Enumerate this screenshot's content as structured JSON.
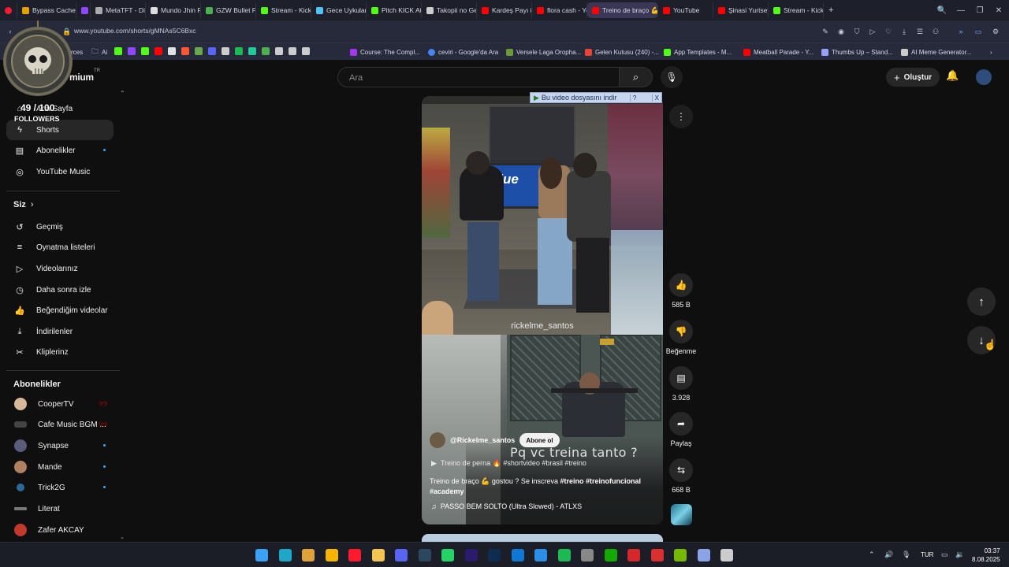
{
  "browser": {
    "tabs": [
      {
        "label": "Bypass Cache",
        "color": "#e5a000"
      },
      {
        "label": "",
        "color": "#9146ff"
      },
      {
        "label": "MetaTFT - Dis",
        "color": "#aaaaaa"
      },
      {
        "label": "Mundo Jhin Re",
        "color": "#dddddd"
      },
      {
        "label": "GZW Bullet Pe",
        "color": "#4caf50"
      },
      {
        "label": "Stream - Kick C",
        "color": "#53fc18"
      },
      {
        "label": "Gece Uykuları",
        "color": "#4fc3f7"
      },
      {
        "label": "Pitch KICK Ath",
        "color": "#53fc18"
      },
      {
        "label": "Takopii no Gen",
        "color": "#cccccc"
      },
      {
        "label": "Kardeş Payı 8.B",
        "color": "#ff0000"
      },
      {
        "label": "flora cash - Yo",
        "color": "#ff0000"
      },
      {
        "label": "Treino de braço 💪 g",
        "color": "#ff0000"
      },
      {
        "label": "YouTube",
        "color": "#ff0000"
      },
      {
        "label": "Şinasi Yurtsev",
        "color": "#ff0000"
      },
      {
        "label": "Stream - Kick C",
        "color": "#53fc18"
      }
    ],
    "active_tab_index": 11,
    "new_tab": "+",
    "url": "www.youtube.com/shorts/gMNAs5C6Bxc",
    "bookmarks": [
      {
        "label": "rces",
        "color": "#888888"
      },
      {
        "label": "Ai",
        "color": "#cccccc"
      },
      {
        "label": "Course: The Compl...",
        "color": "#a435f0"
      },
      {
        "label": "ceviri - Google'da Ara",
        "color": "#4285f4"
      },
      {
        "label": "Versele Laga Oropha...",
        "color": "#6a9a3a"
      },
      {
        "label": "Gelen Kutusu (240) -...",
        "color": "#ea4335"
      },
      {
        "label": "App Templates - M...",
        "color": "#53fc18"
      },
      {
        "label": "Meatball Parade - Y...",
        "color": "#ff0000"
      },
      {
        "label": "Thumbs Up – Stand...",
        "color": "#9aa0ff"
      },
      {
        "label": "AI Meme Generator...",
        "color": "#cccccc"
      }
    ]
  },
  "youtube": {
    "logo_text": "mium",
    "logo_tr": "TR",
    "search_placeholder": "Ara",
    "create_label": "Oluştur",
    "sidebar": {
      "main": [
        {
          "label": "Ana Sayfa",
          "icon": "home-icon"
        },
        {
          "label": "Shorts",
          "icon": "shorts-icon",
          "active": true
        },
        {
          "label": "Abonelikler",
          "icon": "subscriptions-icon"
        },
        {
          "label": "YouTube Music",
          "icon": "music-icon"
        }
      ],
      "you_header": "Siz",
      "you_items": [
        {
          "label": "Geçmiş",
          "icon": "history-icon"
        },
        {
          "label": "Oynatma listeleri",
          "icon": "playlist-icon"
        },
        {
          "label": "Videolarınız",
          "icon": "video-icon"
        },
        {
          "label": "Daha sonra izle",
          "icon": "clock-icon"
        },
        {
          "label": "Beğendiğim videolar",
          "icon": "like-icon"
        },
        {
          "label": "İndirilenler",
          "icon": "download-icon"
        },
        {
          "label": "Kliplerinz",
          "icon": "scissors-icon"
        }
      ],
      "subs_header": "Abonelikler",
      "subs": [
        {
          "label": "CooperTV",
          "color": "#d9b89a",
          "live": true
        },
        {
          "label": "Cafe Music BGM ...",
          "color": "#444444",
          "live": true
        },
        {
          "label": "Synapse",
          "color": "#5a5a7a",
          "live": false,
          "dot": true
        },
        {
          "label": "Mande",
          "color": "#b08060",
          "live": false,
          "dot": true
        },
        {
          "label": "Trick2G",
          "color": "#2a6a9a",
          "live": false,
          "dot": true
        },
        {
          "label": "Literat",
          "color": "#777777",
          "live": false
        },
        {
          "label": "Zafer AKCAY",
          "color": "#c0392b",
          "live": false
        }
      ]
    },
    "overlay": {
      "count": "49 / 100",
      "label": "FOLLOWERS"
    },
    "download_banner": "Bu video dosyasını indir",
    "download_banner_help": "?",
    "download_banner_close": "X",
    "short": {
      "watermark": "rickelme_santos",
      "store_sign": "Blue",
      "overlay_text": "Pq vc treina tanto ?",
      "channel": "@Rickelme_santos",
      "subscribe_label": "Abone ol",
      "related": "Treino de perna 🔥 #shortvideo #brasil #treino",
      "caption_plain": "Treino de braço 💪 gostou ? Se inscreva ",
      "caption_tags": "#treino #treinofuncional",
      "caption_tags2": "#academy",
      "music": "PASSO BEM SOLTO (Ultra Slowed) - ATLXS"
    },
    "actions": {
      "like_count": "585 B",
      "dislike_label": "Beğenme",
      "comment_count": "3.928",
      "share_label": "Paylaş",
      "remix_count": "668 B"
    }
  },
  "taskbar": {
    "apps": [
      {
        "name": "windows-start-icon",
        "color": "#3ba1f0"
      },
      {
        "name": "edge-icon",
        "color": "#1ea7c9"
      },
      {
        "name": "copilot-icon",
        "color": "#e0a33c"
      },
      {
        "name": "chrome-icon",
        "color": "#f4b400"
      },
      {
        "name": "opera-icon",
        "color": "#ff1b2d"
      },
      {
        "name": "explorer-icon",
        "color": "#f6c453"
      },
      {
        "name": "discord-icon",
        "color": "#5865f2"
      },
      {
        "name": "steam-icon",
        "color": "#2a475e"
      },
      {
        "name": "whatsapp-icon",
        "color": "#25d366"
      },
      {
        "name": "premiere-icon",
        "color": "#2b1a6e"
      },
      {
        "name": "photoshop-icon",
        "color": "#0d2c50"
      },
      {
        "name": "outlook-icon",
        "color": "#0f78d4"
      },
      {
        "name": "vscode-icon",
        "color": "#2b8fe6"
      },
      {
        "name": "spotify-icon",
        "color": "#1db954"
      },
      {
        "name": "settings-app-icon",
        "color": "#888888"
      },
      {
        "name": "upwork-icon",
        "color": "#14a800"
      },
      {
        "name": "acrobat-icon",
        "color": "#d4282a"
      },
      {
        "name": "z-app-icon",
        "color": "#d93030"
      },
      {
        "name": "nvidia-icon",
        "color": "#76b900"
      },
      {
        "name": "launcher-icon",
        "color": "#8ba4e6"
      },
      {
        "name": "gear-tb-icon",
        "color": "#cccccc"
      }
    ],
    "lang": "TUR",
    "time": "03:37",
    "date": "8.08.2025"
  }
}
